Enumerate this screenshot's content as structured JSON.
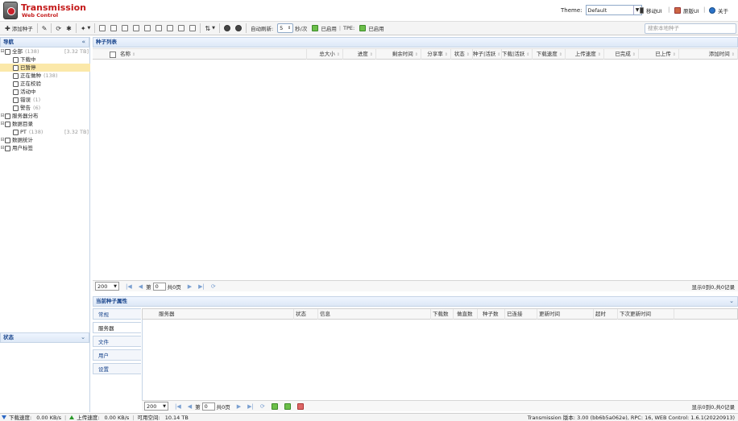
{
  "header": {
    "title": "Transmission",
    "subtitle": "Web Control",
    "theme_label": "Theme:",
    "theme_value": "Default",
    "links": [
      "移动UI",
      "原版UI",
      "关于"
    ]
  },
  "toolbar": {
    "add_torrent": "添加种子",
    "auto_refresh": "自动刷新:",
    "refresh_value": "5",
    "refresh_unit": "秒/次",
    "status1": "已启用",
    "tpe_label": "TPE:",
    "status2": "已启用",
    "search_placeholder": "搜索本地种子"
  },
  "nav": {
    "title": "导航",
    "items": [
      {
        "label": "全部",
        "count": "(138)",
        "size": "[3.32 TB]",
        "icon": "home-icon",
        "level": 0
      },
      {
        "label": "下载中",
        "count": "",
        "size": "",
        "icon": "download-icon",
        "level": 1
      },
      {
        "label": "已暂停",
        "count": "",
        "size": "",
        "icon": "pause-icon",
        "level": 1
      },
      {
        "label": "正在做种",
        "count": "(138)",
        "size": "",
        "icon": "upload-icon",
        "level": 1
      },
      {
        "label": "正在校验",
        "count": "",
        "size": "",
        "icon": "check-icon",
        "level": 1
      },
      {
        "label": "活动中",
        "count": "",
        "size": "",
        "icon": "link-icon",
        "level": 1
      },
      {
        "label": "错误",
        "count": "(1)",
        "size": "",
        "icon": "error-icon",
        "level": 1
      },
      {
        "label": "警告",
        "count": "(6)",
        "size": "",
        "icon": "warning-icon",
        "level": 1
      },
      {
        "label": "服务器分布",
        "count": "",
        "size": "",
        "icon": "server-icon",
        "level": 0
      },
      {
        "label": "数据目录",
        "count": "",
        "size": "",
        "icon": "folder-icon",
        "level": 0
      },
      {
        "label": "PT",
        "count": "(138)",
        "size": "[3.32 TB]",
        "icon": "folder-icon",
        "level": 1
      },
      {
        "label": "数据统计",
        "count": "",
        "size": "",
        "icon": "chart-icon",
        "level": 0
      },
      {
        "label": "用户标签",
        "count": "",
        "size": "",
        "icon": "tag-icon",
        "level": 0
      }
    ],
    "status_title": "状态"
  },
  "list": {
    "title": "种子列表",
    "columns": [
      "名称",
      "总大小",
      "进度",
      "剩余时间",
      "分享率",
      "状态",
      "种子|活跃",
      "下载|活跃",
      "下载速度",
      "上传速度",
      "已完成",
      "已上传",
      "添加时间"
    ],
    "page_size": "200",
    "page_prefix": "第",
    "page_value": "0",
    "page_total": "共0页",
    "info": "显示0到0,共0记录"
  },
  "props": {
    "title": "当前种子属性",
    "tabs": [
      "常规",
      "服务器",
      "文件",
      "用户",
      "设置"
    ],
    "active_tab": 1,
    "columns": [
      "服务器",
      "状态",
      "信息",
      "下载数",
      "做直数",
      "种子数",
      "已连接",
      "更新时间",
      "超时",
      "下次更新时间"
    ],
    "page_size": "200",
    "page_prefix": "第",
    "page_value": "0",
    "page_total": "共0页",
    "info": "显示0到0,共0记录"
  },
  "statusbar": {
    "down_label": "下载速度:",
    "down_value": "0.00 KB/s",
    "up_label": "上传速度:",
    "up_value": "0.00 KB/s",
    "free_label": "可用空间:",
    "free_value": "10.14 TB",
    "version": "Transmission 版本: 3.00 (bb6b5a062e), RPC: 16, WEB Control: 1.6.1(20220913)"
  }
}
